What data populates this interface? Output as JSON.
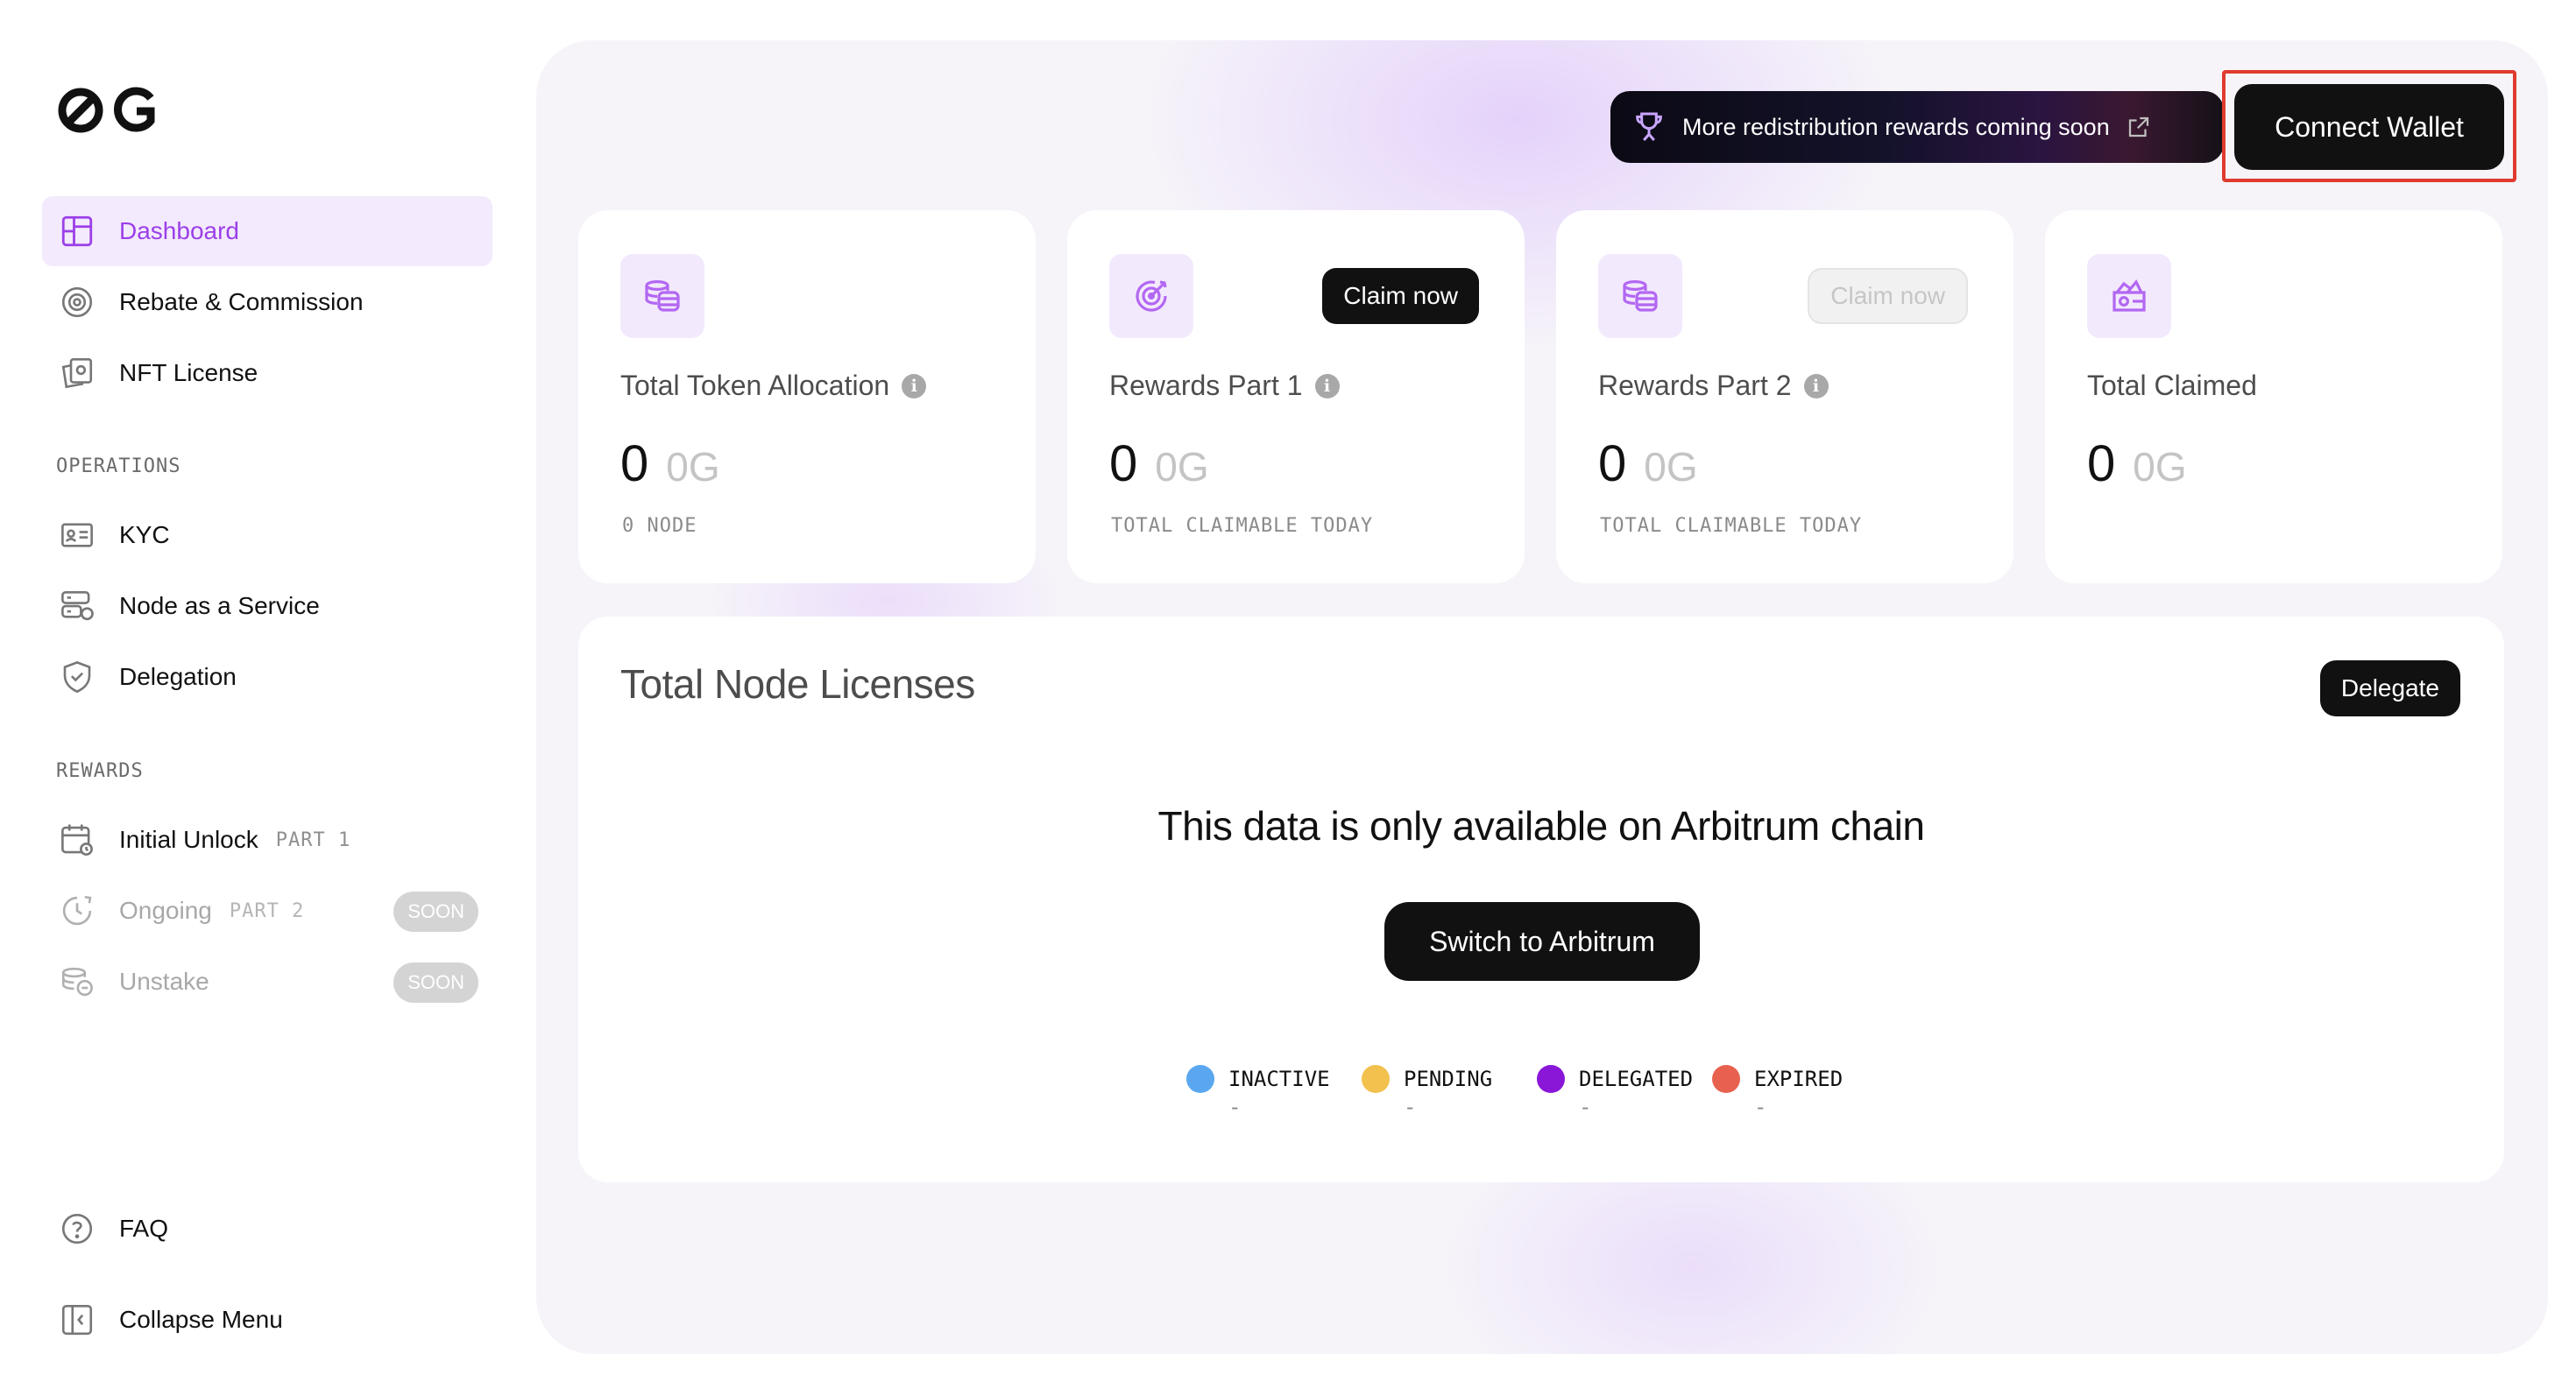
{
  "logo": {
    "text": "0G"
  },
  "sidebar": {
    "main_items": [
      {
        "label": "Dashboard",
        "icon": "dashboard-icon",
        "active": true
      },
      {
        "label": "Rebate & Commission",
        "icon": "rebate-icon"
      },
      {
        "label": "NFT License",
        "icon": "nft-license-icon"
      }
    ],
    "operations_label": "OPERATIONS",
    "operations_items": [
      {
        "label": "KYC",
        "icon": "id-card-icon"
      },
      {
        "label": "Node as a Service",
        "icon": "server-icon"
      },
      {
        "label": "Delegation",
        "icon": "shield-check-icon"
      }
    ],
    "rewards_label": "REWARDS",
    "rewards_items": [
      {
        "label": "Initial Unlock",
        "part": "PART 1",
        "icon": "calendar-icon"
      },
      {
        "label": "Ongoing",
        "part": "PART 2",
        "badge": "SOON",
        "icon": "clock-icon",
        "disabled": true
      },
      {
        "label": "Unstake",
        "badge": "SOON",
        "icon": "coins-icon",
        "disabled": true
      }
    ],
    "faq": {
      "label": "FAQ",
      "icon": "question-icon"
    },
    "collapse": {
      "label": "Collapse Menu",
      "icon": "collapse-icon"
    }
  },
  "header": {
    "banner_text": "More redistribution rewards coming soon",
    "connect_label": "Connect Wallet"
  },
  "cards": [
    {
      "title": "Total Token Allocation",
      "value": "0",
      "unit": "0G",
      "sub": "0 NODE",
      "icon": "coin-stack-icon"
    },
    {
      "title": "Rewards Part 1",
      "value": "0",
      "unit": "0G",
      "sub": "TOTAL CLAIMABLE TODAY",
      "button": "Claim now",
      "icon": "target-icon"
    },
    {
      "title": "Rewards Part 2",
      "value": "0",
      "unit": "0G",
      "sub": "TOTAL CLAIMABLE TODAY",
      "button": "Claim now",
      "icon": "coin-stack-icon"
    },
    {
      "title": "Total Claimed",
      "value": "0",
      "unit": "0G",
      "icon": "wallet-icon"
    }
  ],
  "licenses": {
    "title": "Total Node Licenses",
    "delegate_label": "Delegate",
    "message": "This data is only available on Arbitrum chain",
    "switch_label": "Switch to Arbitrum",
    "legend": [
      {
        "label": "INACTIVE",
        "value": "-",
        "color": "#5aa7f0"
      },
      {
        "label": "PENDING",
        "value": "-",
        "color": "#f2c14e"
      },
      {
        "label": "DELEGATED",
        "value": "-",
        "color": "#8a17d8"
      },
      {
        "label": "EXPIRED",
        "value": "-",
        "color": "#e8614f"
      }
    ]
  },
  "colors": {
    "accent": "#9b3fe8",
    "highlight_outline": "#e03a2f"
  }
}
